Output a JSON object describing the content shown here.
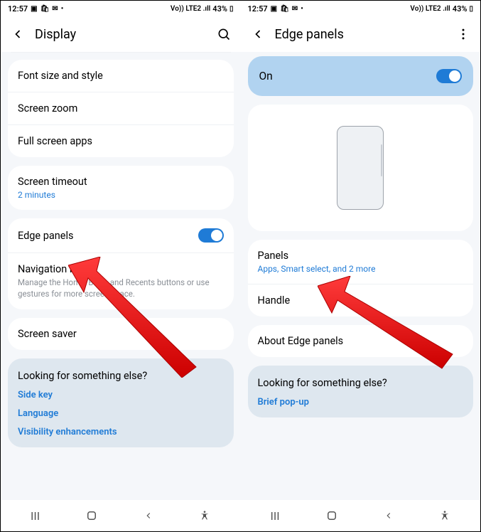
{
  "status": {
    "time": "12:57",
    "battery": "43%",
    "signal": "Vo)) LTE2 .ıll"
  },
  "left": {
    "title": "Display",
    "items": {
      "font": "Font size and style",
      "zoom": "Screen zoom",
      "fullscreen": "Full screen apps",
      "timeout": "Screen timeout",
      "timeout_sub": "2 minutes",
      "edge": "Edge panels",
      "nav": "Navigation bar",
      "nav_sub": "Manage the Home, Back, and Recents buttons or use gestures for more screen space.",
      "saver": "Screen saver"
    },
    "looking": {
      "title": "Looking for something else?",
      "links": [
        "Side key",
        "Language",
        "Visibility enhancements"
      ]
    }
  },
  "right": {
    "title": "Edge panels",
    "toggle_label": "On",
    "items": {
      "panels": "Panels",
      "panels_sub": "Apps, Smart select, and 2 more",
      "handle": "Handle",
      "about": "About Edge panels"
    },
    "looking": {
      "title": "Looking for something else?",
      "links": [
        "Brief pop-up"
      ]
    }
  }
}
